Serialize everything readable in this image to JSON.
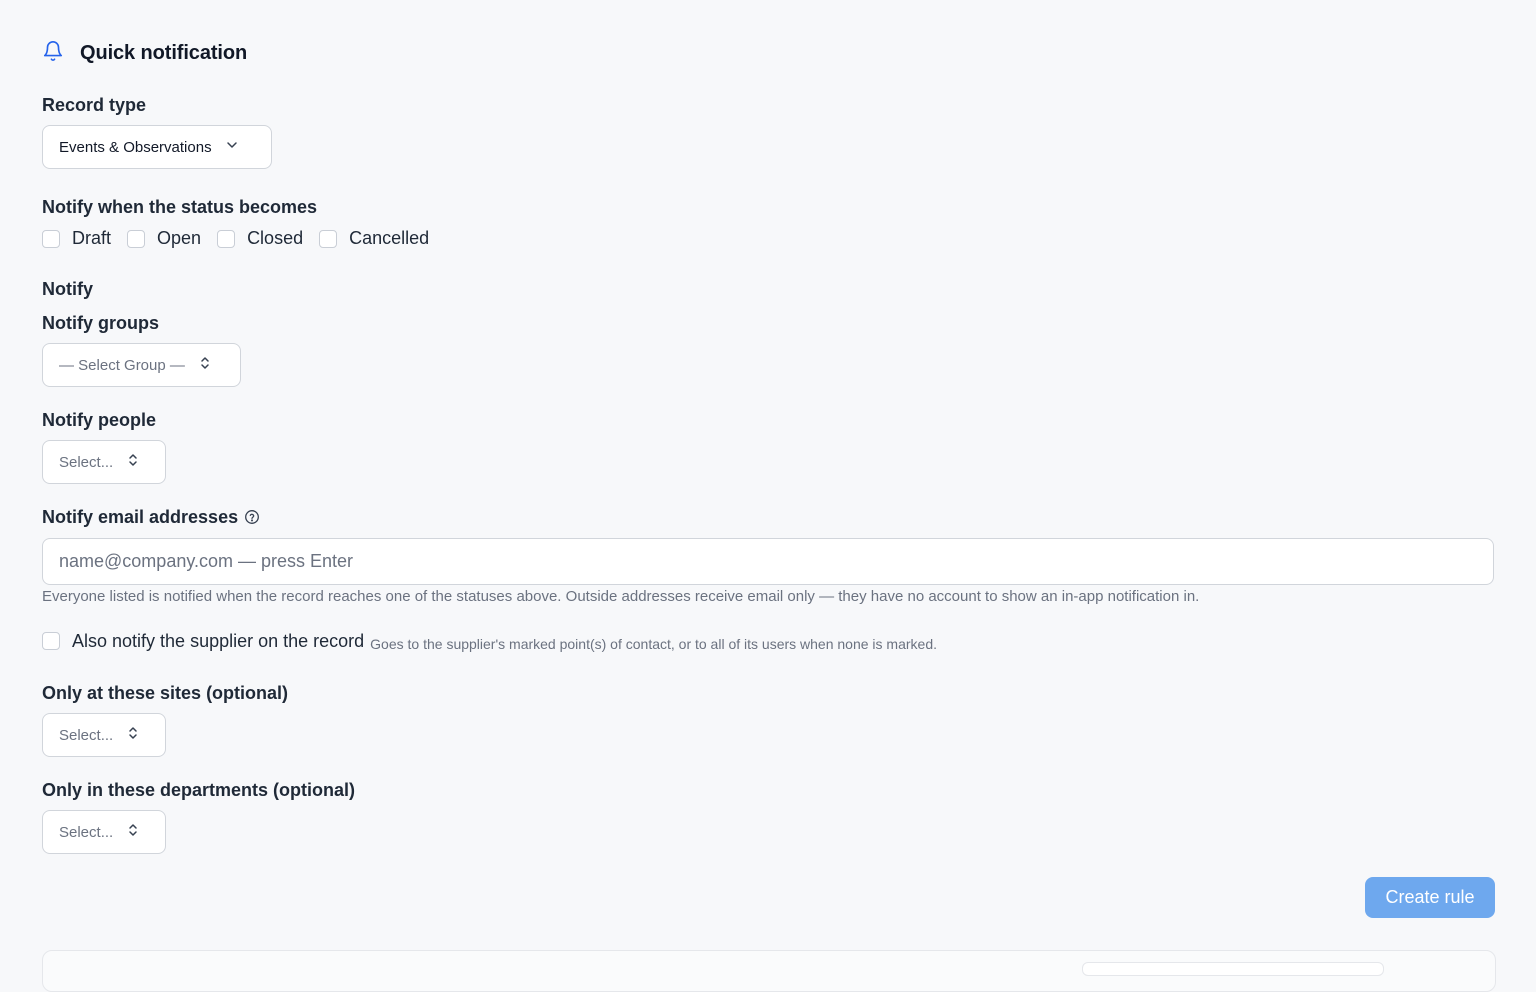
{
  "header": {
    "title": "Quick notification",
    "icon": "bell-icon"
  },
  "record_type": {
    "label": "Record type",
    "value": "Events & Observations"
  },
  "status": {
    "label": "Notify when the status becomes",
    "options": [
      {
        "label": "Draft",
        "checked": false
      },
      {
        "label": "Open",
        "checked": false
      },
      {
        "label": "Closed",
        "checked": false
      },
      {
        "label": "Cancelled",
        "checked": false
      }
    ]
  },
  "notify": {
    "section_label": "Notify",
    "groups": {
      "label": "Notify groups",
      "placeholder": "— Select Group —"
    },
    "people": {
      "label": "Notify people",
      "placeholder": "Select..."
    },
    "emails": {
      "label": "Notify email addresses",
      "placeholder": "name@company.com — press Enter",
      "value": "",
      "hint": "Everyone listed is notified when the record reaches one of the statuses above. Outside addresses receive email only — they have no account to show an in-app notification in."
    },
    "supplier": {
      "label": "Also notify the supplier on the record",
      "sub": "Goes to the supplier's marked point(s) of contact, or to all of its users when none is marked.",
      "checked": false
    }
  },
  "sites": {
    "label": "Only at these sites (optional)",
    "placeholder": "Select..."
  },
  "departments": {
    "label": "Only in these departments (optional)",
    "placeholder": "Select..."
  },
  "actions": {
    "create_label": "Create rule"
  },
  "colors": {
    "accent": "#6ea8ee",
    "icon": "#2563eb",
    "background": "#f7f8fa"
  }
}
